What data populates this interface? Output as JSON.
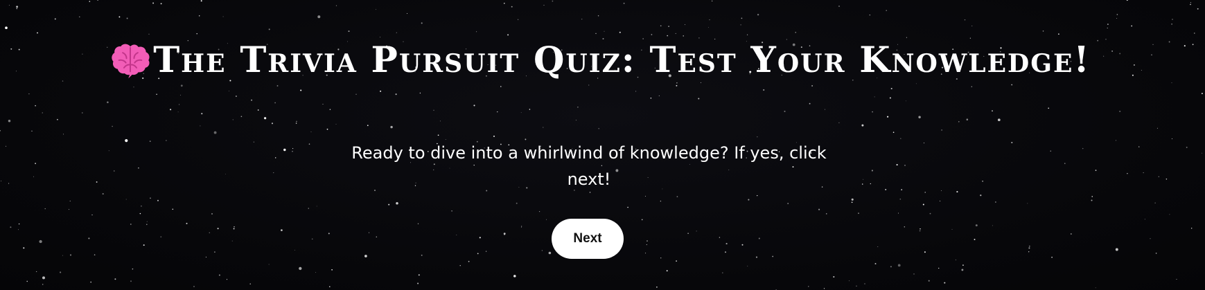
{
  "page": {
    "title_icon": "brain-icon",
    "title": "The Trivia Pursuit Quiz: Test Your Knowledge!",
    "intro_text": "Ready to dive into a whirlwind of knowledge? If yes, click next!",
    "next_button_label": "Next"
  },
  "colors": {
    "background": "#07070a",
    "title_text": "#ffffff",
    "button_bg": "#ffffff",
    "button_text": "#111111",
    "brain_icon": "#f25db7"
  }
}
